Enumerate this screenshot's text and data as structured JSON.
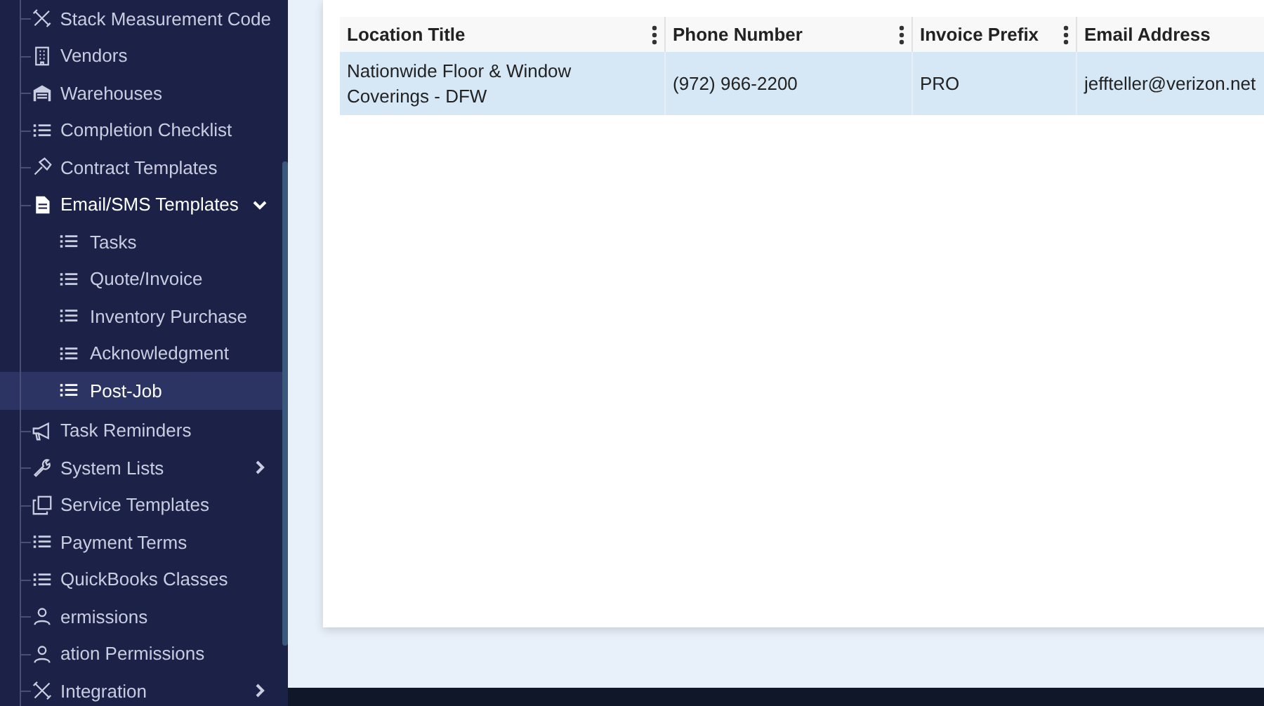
{
  "sidebar": {
    "items": [
      {
        "label": "Stack Measurement Code",
        "selected": false
      },
      {
        "label": "Vendors",
        "selected": false
      },
      {
        "label": "Warehouses",
        "selected": false
      },
      {
        "label": "Completion Checklist",
        "selected": false
      },
      {
        "label": "Contract Templates",
        "selected": false
      },
      {
        "label": "Email/SMS Templates",
        "selected": false,
        "expanded": true,
        "children": [
          {
            "label": "Tasks",
            "selected": false
          },
          {
            "label": "Quote/Invoice",
            "selected": false
          },
          {
            "label": "Inventory Purchase",
            "selected": false
          },
          {
            "label": "Acknowledgment",
            "selected": false
          },
          {
            "label": "Post-Job",
            "selected": true
          }
        ]
      },
      {
        "label": "Task Reminders",
        "selected": false
      },
      {
        "label": "System Lists",
        "selected": false,
        "expanded": false
      },
      {
        "label": "Service Templates",
        "selected": false
      },
      {
        "label": "Payment Terms",
        "selected": false
      },
      {
        "label": "QuickBooks Classes",
        "selected": false
      },
      {
        "label": "ermissions",
        "selected": false
      },
      {
        "label": "ation Permissions",
        "selected": false
      },
      {
        "label": "Integration",
        "selected": false,
        "expanded": false
      }
    ]
  },
  "table": {
    "columns": [
      {
        "label": "Location Title",
        "menu": true
      },
      {
        "label": "Phone Number",
        "menu": true
      },
      {
        "label": "Invoice Prefix",
        "menu": true
      },
      {
        "label": "Email Address",
        "menu": false
      }
    ],
    "rows": [
      {
        "selected": true,
        "cells": [
          "Nationwide Floor & Window Coverings - DFW",
          "(972) 966-2200",
          "PRO",
          "jeffteller@verizon.net"
        ]
      }
    ]
  }
}
